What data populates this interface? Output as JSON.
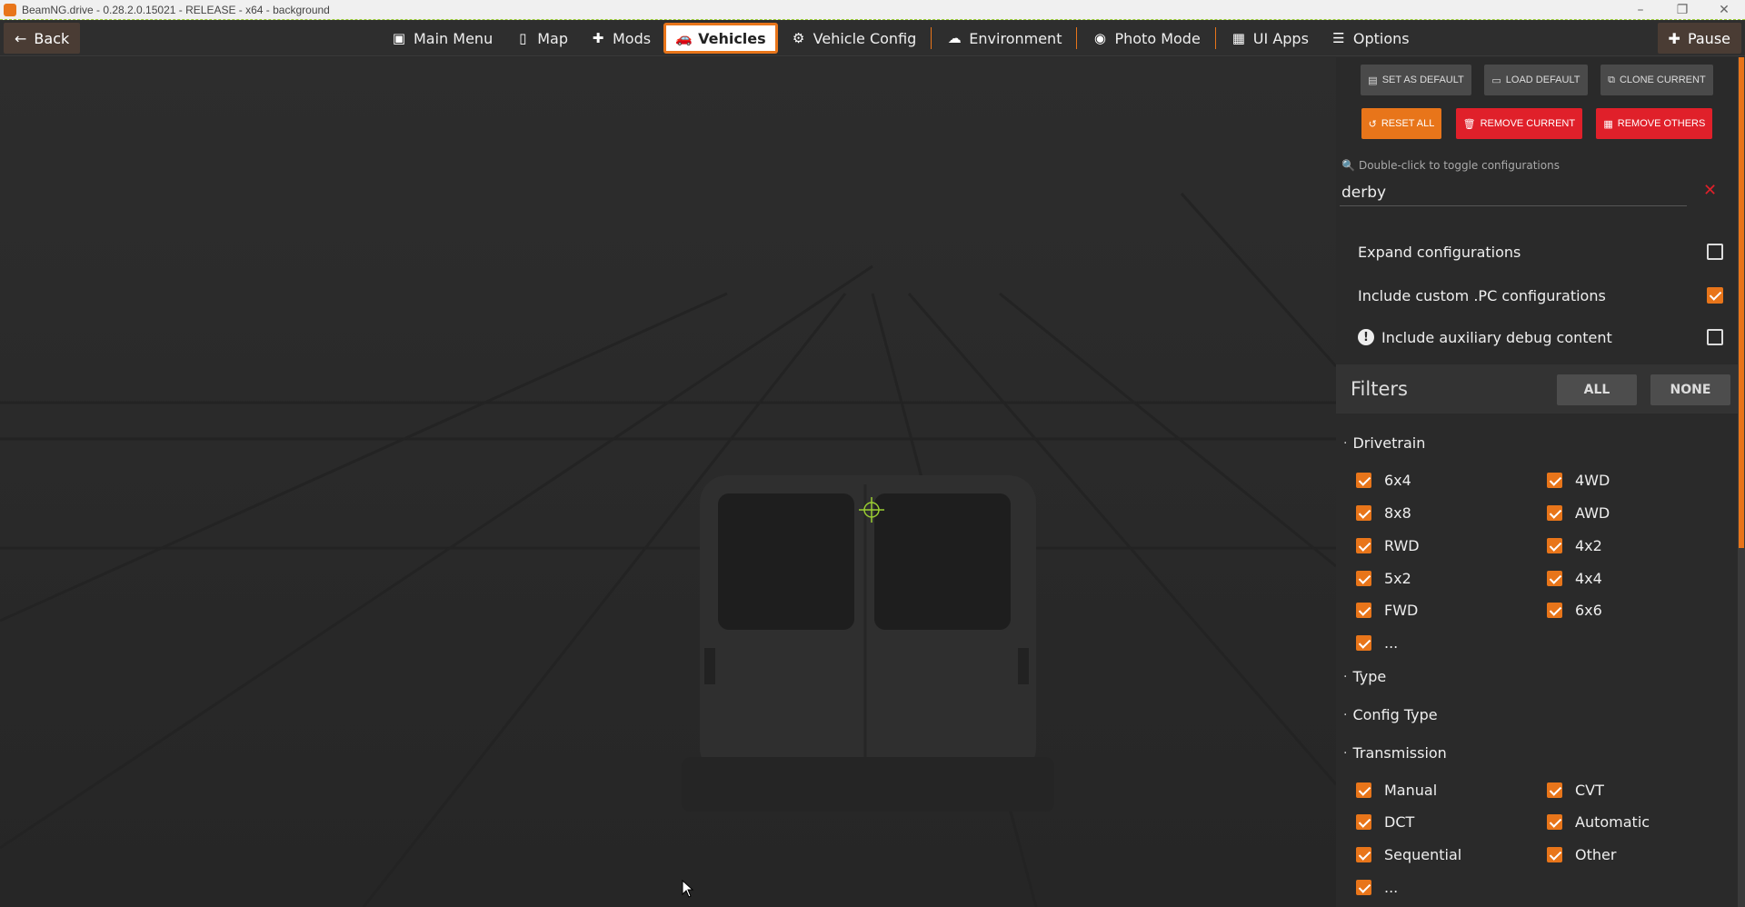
{
  "titlebar": {
    "title": "BeamNG.drive - 0.28.2.0.15021 - RELEASE - x64 - background",
    "min": "–",
    "max": "❐",
    "close": "✕"
  },
  "topbar": {
    "back": "Back",
    "nav": [
      {
        "label": "Main Menu",
        "icon": "▣"
      },
      {
        "label": "Map",
        "icon": "▯"
      },
      {
        "label": "Mods",
        "icon": "✚"
      },
      {
        "label": "Vehicles",
        "icon": "🚗"
      },
      {
        "label": "Vehicle Config",
        "icon": "⚙"
      },
      {
        "label": "Environment",
        "icon": "☁"
      },
      {
        "label": "Photo Mode",
        "icon": "◉"
      },
      {
        "label": "UI Apps",
        "icon": "▦"
      },
      {
        "label": "Options",
        "icon": "☰"
      }
    ],
    "pause": "Pause"
  },
  "panel": {
    "buttons_row1": [
      "SET AS DEFAULT",
      "LOAD DEFAULT",
      "CLONE CURRENT"
    ],
    "buttons_row2": [
      "RESET ALL",
      "REMOVE CURRENT",
      "REMOVE OTHERS"
    ],
    "search_hint": "Double-click to toggle configurations",
    "search_value": "derby",
    "options": [
      {
        "label": "Expand configurations",
        "checked": false
      },
      {
        "label": "Include custom .PC configurations",
        "checked": true
      },
      {
        "label": "Include auxiliary debug content",
        "checked": false
      }
    ],
    "filters": {
      "title": "Filters",
      "all": "ALL",
      "none": "NONE"
    },
    "sections": {
      "drivetrain": {
        "title": "Drivetrain",
        "items": [
          "6x4",
          "4WD",
          "8x8",
          "AWD",
          "RWD",
          "4x2",
          "5x2",
          "4x4",
          "FWD",
          "6x6",
          "..."
        ]
      },
      "type": {
        "title": "Type"
      },
      "config_type": {
        "title": "Config Type"
      },
      "transmission": {
        "title": "Transmission",
        "items": [
          "Manual",
          "CVT",
          "DCT",
          "Automatic",
          "Sequential",
          "Other",
          "..."
        ]
      }
    }
  },
  "colors": {
    "accent": "#e8751a",
    "danger": "#e0202a",
    "panel": "#2a2a2a"
  }
}
